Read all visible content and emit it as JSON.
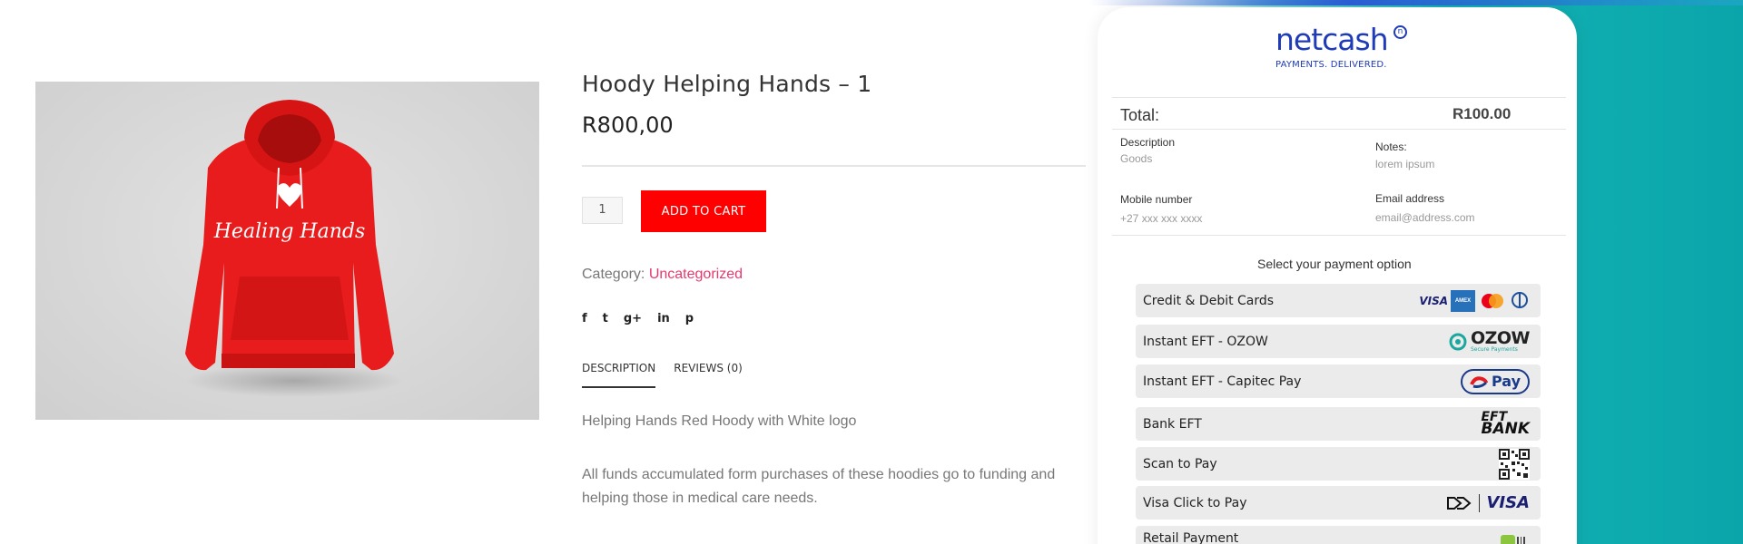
{
  "product": {
    "title": "Hoody Helping Hands – 1",
    "price": "R800,00",
    "quantity": "1",
    "add_to_cart": "ADD TO CART",
    "category_label": "Category:",
    "category_value": "Uncategorized",
    "image_text": "Healing Hands",
    "share_icons": [
      "facebook-icon",
      "twitter-icon",
      "google-plus-icon",
      "linkedin-icon",
      "pinterest-icon"
    ],
    "share_glyphs": [
      "f",
      "t",
      "g+",
      "in",
      "p"
    ],
    "tabs": [
      {
        "label": "DESCRIPTION",
        "active": true
      },
      {
        "label": "REVIEWS (0)",
        "active": false
      }
    ],
    "description": [
      "Helping Hands Red Hoody with White logo",
      "All funds accumulated form purchases of these hoodies go to funding and helping those in medical care needs."
    ]
  },
  "payment": {
    "logo_word": "netcash",
    "logo_mark": "n",
    "logo_tagline": "PAYMENTS. DELIVERED.",
    "total_label": "Total:",
    "total_value": "R100.00",
    "description_label": "Description",
    "description_value": "Goods",
    "notes_label": "Notes:",
    "notes_value": "lorem ipsum",
    "mobile_label": "Mobile number",
    "mobile_value": "+27 xxx xxx xxxx",
    "email_label": "Email address",
    "email_value": "email@address.com",
    "select_title": "Select your payment option",
    "options": [
      {
        "label": "Credit & Debit Cards",
        "logo": "card-logos-icon"
      },
      {
        "label": "Instant EFT - OZOW",
        "logo": "ozow-logo-icon",
        "logo_text": "OZOW",
        "logo_sub": "Secure Payments"
      },
      {
        "label": "Instant EFT - Capitec Pay",
        "logo": "capitec-pay-icon",
        "logo_text": "Pay"
      },
      {
        "label": "Bank EFT",
        "logo": "eft-bank-icon",
        "logo_text": "EFT",
        "logo_text2": "BANK"
      },
      {
        "label": "Scan to Pay",
        "logo": "qr-code-icon"
      },
      {
        "label": "Visa Click to Pay",
        "logo": "visa-click-to-pay-icon",
        "logo_text": "VISA"
      },
      {
        "label": "Retail Payment",
        "logo": "retail-payment-icon"
      }
    ],
    "card_brands": {
      "visa": "VISA",
      "amex": "AMEX"
    }
  },
  "colors": {
    "accent_red": "#ff0000",
    "category_pink": "#e8386f",
    "netcash_blue": "#1f3bb8",
    "teal": "#0aa5aa"
  }
}
